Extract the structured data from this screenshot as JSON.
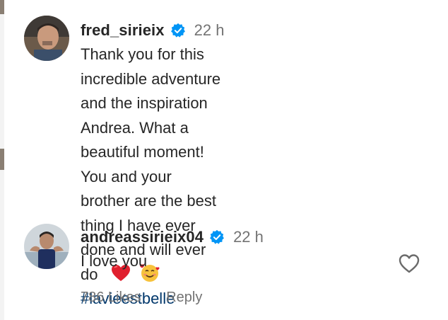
{
  "comments": [
    {
      "username": "fred_sirieix",
      "time": "22 h",
      "lines": [
        "Thank you for this incredible adventure",
        "and the inspiration Andrea. What a",
        "beautiful moment! You and your",
        "brother are the best thing I have ever",
        "done and will ever do"
      ],
      "emojis": [
        "red-heart",
        "smiling-face-with-hearts"
      ],
      "hashtag": "#lavieestbelle"
    },
    {
      "username": "andreassirieix04",
      "time": "22 h",
      "text": "I love you",
      "likes": "786 Likes",
      "reply": "Reply"
    }
  ],
  "icons": {
    "verified": "verified-badge-icon",
    "like": "heart-outline-icon"
  },
  "colors": {
    "verified_blue": "#0095f6",
    "hashtag": "#00376b",
    "secondary_text": "#737373",
    "primary_text": "#262626"
  }
}
